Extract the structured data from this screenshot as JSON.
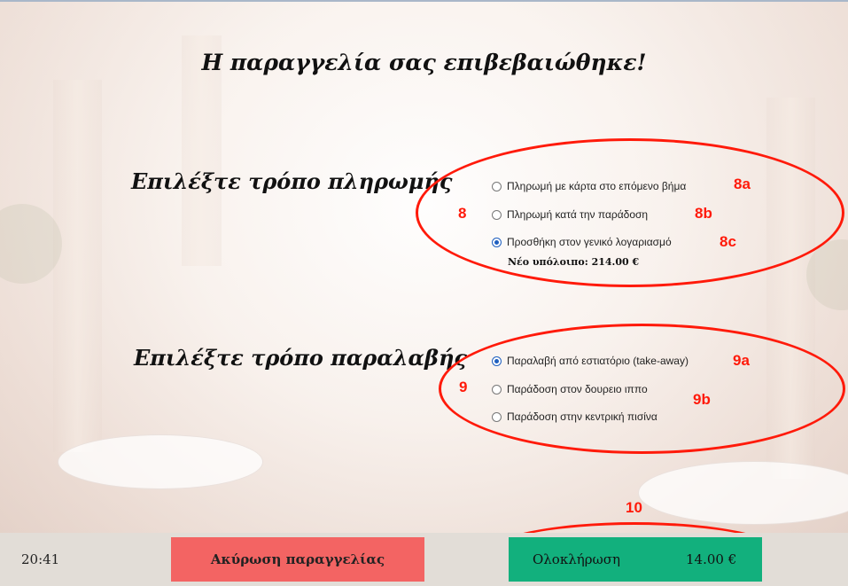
{
  "title": "Η παραγγελία σας επιβεβαιώθηκε!",
  "payment": {
    "label": "Επιλέξτε τρόπο πληρωμής",
    "options": [
      {
        "label": "Πληρωμή με κάρτα στο επόμενο βήμα",
        "selected": false,
        "annotation": "8a"
      },
      {
        "label": "Πληρωμή κατά την παράδοση",
        "selected": false,
        "annotation": "8b"
      },
      {
        "label": "Προσθήκη στον γενικό λογαριασμό",
        "selected": true,
        "annotation": "8c"
      }
    ],
    "balance": "Νέο υπόλοιπο: 214.00 €",
    "annotation": "8"
  },
  "delivery": {
    "label": "Επιλέξτε τρόπο παραλαβής",
    "options": [
      {
        "label": "Παραλαβή από εστιατόριο (take-away)",
        "selected": true,
        "annotation": "9a"
      },
      {
        "label": "Παράδοση στον δουρειο ιππο",
        "selected": false,
        "annotation": "9b"
      },
      {
        "label": "Παράδοση στην κεντρική πισίνα",
        "selected": false
      }
    ],
    "annotation": "9"
  },
  "footer": {
    "clock": "20:41",
    "cancel_label": "Ακύρωση παραγγελίας",
    "complete_label": "Ολοκλήρωση",
    "complete_price": "14.00 €",
    "annotation": "10"
  },
  "colors": {
    "annotation_red": "#ff1a0a",
    "cancel": "#f36463",
    "complete": "#12b07d",
    "radio_selected": "#1f5fbf"
  }
}
